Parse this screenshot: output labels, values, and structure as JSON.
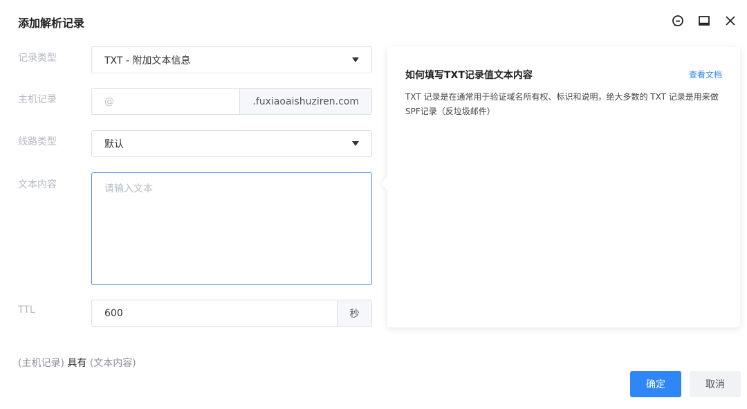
{
  "dialog": {
    "title": "添加解析记录"
  },
  "icons": [
    "chat-icon",
    "minimize-icon",
    "close-icon"
  ],
  "form": {
    "record_type": {
      "label": "记录类型",
      "value": "TXT - 附加文本信息"
    },
    "host": {
      "label": "主机记录",
      "placeholder": "@",
      "suffix": ".fuxiaoaishuziren.com"
    },
    "line_type": {
      "label": "线路类型",
      "value": "默认"
    },
    "text_content": {
      "label": "文本内容",
      "placeholder": "请输入文本"
    },
    "ttl": {
      "label": "TTL",
      "value": "600",
      "unit": "秒"
    }
  },
  "help": {
    "title": "如何填写TXT记录值文本内容",
    "link": "查看文档",
    "body": "TXT 记录是在通常用于验证域名所有权、标识和说明，绝大多数的 TXT 记录是用来做SPF记录（反垃圾邮件）"
  },
  "summary": {
    "left": "(主机记录)",
    "mid": "具有",
    "right": "(文本内容)"
  },
  "buttons": {
    "ok": "确定",
    "cancel": "取消"
  },
  "colors": {
    "accent": "#2f86f6",
    "label": "#b4b9c2",
    "focus_border": "#4a90e2"
  }
}
